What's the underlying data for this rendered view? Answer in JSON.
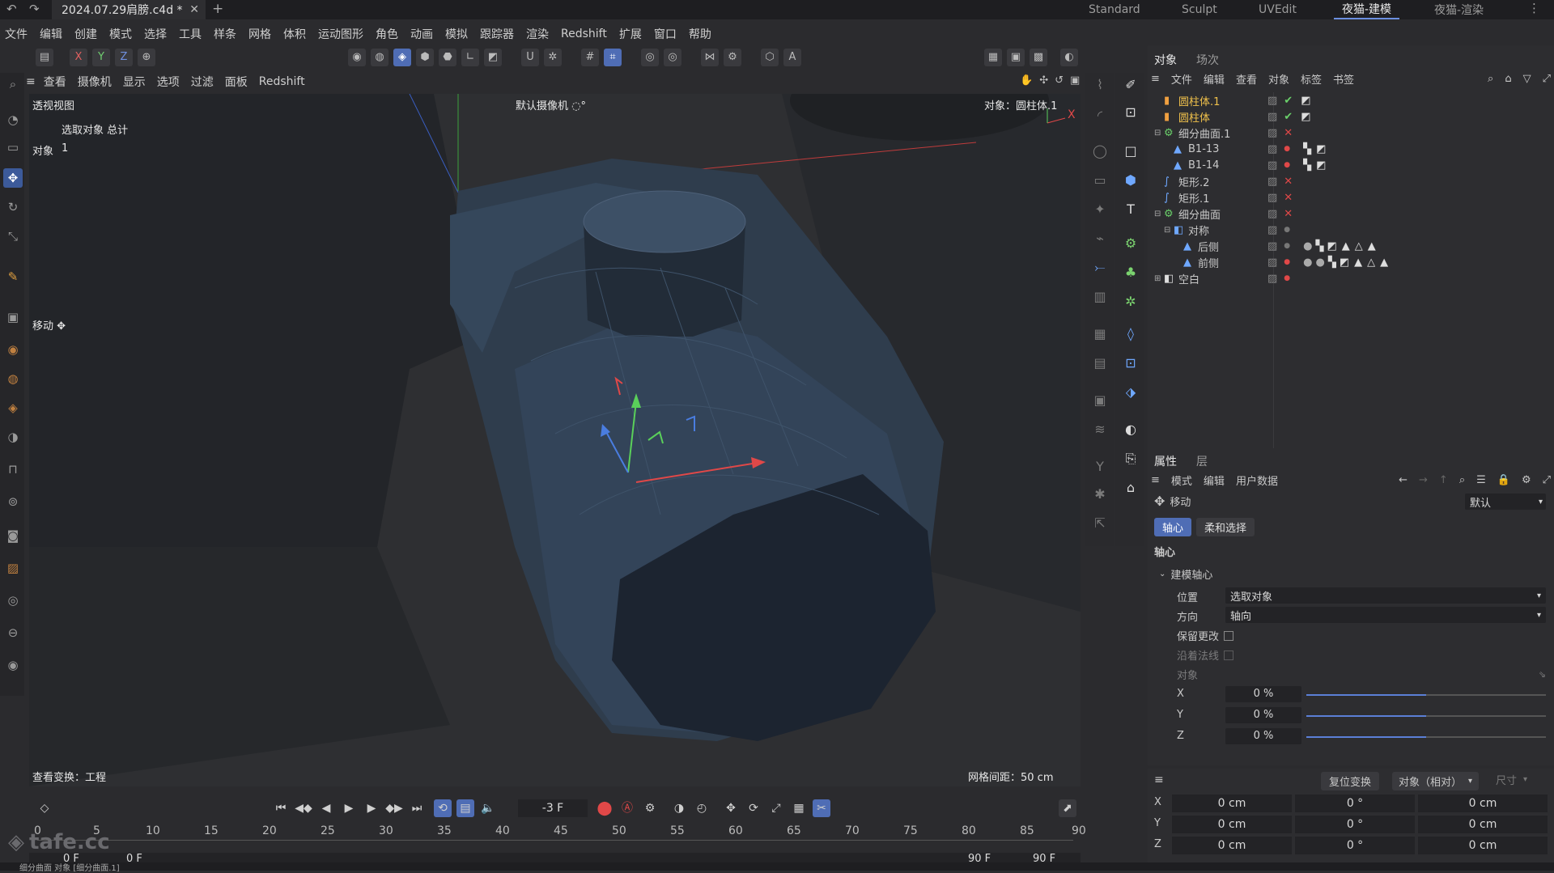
{
  "titlebar": {
    "document_tab": "2024.07.29肩膀.c4d *",
    "layouts": [
      "Standard",
      "Sculpt",
      "UVEdit",
      "夜猫-建模",
      "夜猫-渲染"
    ],
    "active_layout": "夜猫-建模"
  },
  "menu": [
    "文件",
    "编辑",
    "创建",
    "模式",
    "选择",
    "工具",
    "样条",
    "网格",
    "体积",
    "运动图形",
    "角色",
    "动画",
    "模拟",
    "跟踪器",
    "渲染",
    "Redshift",
    "扩展",
    "窗口",
    "帮助"
  ],
  "axis_toggles": [
    "X",
    "Y",
    "Z"
  ],
  "viewport_menu": [
    "查看",
    "摄像机",
    "显示",
    "选项",
    "过滤",
    "面板",
    "Redshift"
  ],
  "viewport": {
    "view_name": "透视视图",
    "camera": "默认摄像机 ◌°",
    "selected_label": "选取对象 总计",
    "object_count_label": "对象",
    "object_count": "1",
    "object_indicator": "对象：圆柱体.1",
    "tool_label": "移动 ✥",
    "view_transform": "查看变换：工程",
    "grid_spacing": "网格间距：50 cm"
  },
  "timeline": {
    "current_frame": "-3 F",
    "ruler": [
      "0",
      "5",
      "10",
      "15",
      "20",
      "25",
      "30",
      "35",
      "40",
      "45",
      "50",
      "55",
      "60",
      "65",
      "70",
      "75",
      "80",
      "85",
      "90"
    ],
    "start_frame": "0 F",
    "preview_start": "0 F",
    "preview_end": "90 F",
    "end_frame": "90 F"
  },
  "object_manager": {
    "tabs": [
      "对象",
      "场次"
    ],
    "menu": [
      "文件",
      "编辑",
      "查看",
      "对象",
      "标签",
      "书签"
    ],
    "objects": [
      {
        "name": "圆柱体.1",
        "indent": 0,
        "selected": true,
        "status": "check"
      },
      {
        "name": "圆柱体",
        "indent": 0,
        "selected": true,
        "status": "check"
      },
      {
        "name": "细分曲面.1",
        "indent": 0,
        "selected": false,
        "status": "x"
      },
      {
        "name": "B1-13",
        "indent": 1,
        "selected": false,
        "status": ""
      },
      {
        "name": "B1-14",
        "indent": 1,
        "selected": false,
        "status": ""
      },
      {
        "name": "矩形.2",
        "indent": 0,
        "selected": false,
        "status": "x"
      },
      {
        "name": "矩形.1",
        "indent": 0,
        "selected": false,
        "status": "x"
      },
      {
        "name": "细分曲面",
        "indent": 0,
        "selected": false,
        "status": "x"
      },
      {
        "name": "对称",
        "indent": 1,
        "selected": false,
        "status": ""
      },
      {
        "name": "后侧",
        "indent": 2,
        "selected": false,
        "status": ""
      },
      {
        "name": "前侧",
        "indent": 2,
        "selected": false,
        "status": ""
      },
      {
        "name": "空白",
        "indent": 0,
        "selected": false,
        "status": ""
      }
    ]
  },
  "attributes": {
    "tabs": [
      "属性",
      "层"
    ],
    "menu": [
      "模式",
      "编辑",
      "用户数据"
    ],
    "tool_name": "移动",
    "preset": "默认",
    "subtabs": [
      "轴心",
      "柔和选择"
    ],
    "section": "轴心",
    "group": "建模轴心",
    "position_label": "位置",
    "position_value": "选取对象",
    "direction_label": "方向",
    "direction_value": "轴向",
    "keep_label": "保留更改",
    "normal_label": "沿着法线",
    "object_label": "对象",
    "x_label": "X",
    "x_value": "0 %",
    "x_level": 0.5,
    "y_label": "Y",
    "y_value": "0 %",
    "y_level": 0.5,
    "z_label": "Z",
    "z_value": "0 %",
    "z_level": 0.5
  },
  "coord": {
    "reset_button": "复位变换",
    "mode": "对象（相对）",
    "size_label": "尺寸",
    "rows": [
      {
        "axis": "X",
        "pos": "0 cm",
        "rot": "0 °",
        "size": "0 cm"
      },
      {
        "axis": "Y",
        "pos": "0 cm",
        "rot": "0 °",
        "size": "0 cm"
      },
      {
        "axis": "Z",
        "pos": "0 cm",
        "rot": "0 °",
        "size": "0 cm"
      }
    ]
  },
  "status": {
    "watermark": "tafe.cc",
    "message": "细分曲面 对象 [细分曲面.1]"
  },
  "colors": {
    "accent": "#4f6db5",
    "selected_text": "#f0c14b",
    "axis_x": "#e04848",
    "axis_y": "#5ad05a",
    "axis_z": "#4a7de0"
  }
}
